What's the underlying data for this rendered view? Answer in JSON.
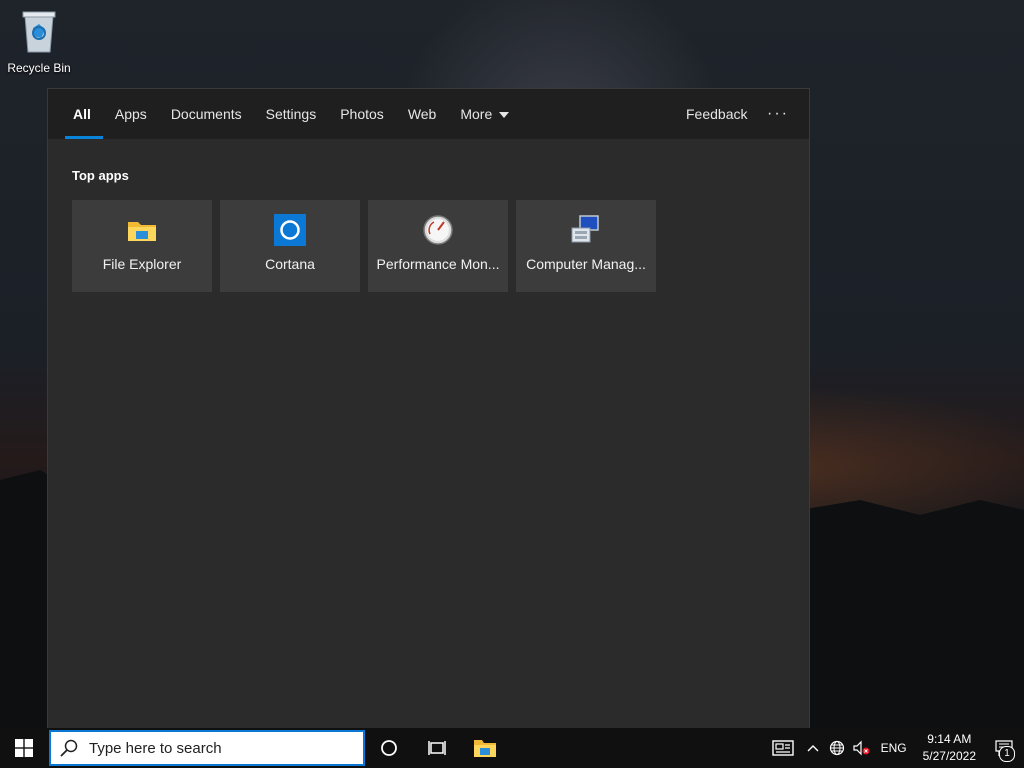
{
  "desktop": {
    "recycle_bin_label": "Recycle Bin"
  },
  "search_flyout": {
    "tabs": [
      {
        "label": "All",
        "active": true
      },
      {
        "label": "Apps"
      },
      {
        "label": "Documents"
      },
      {
        "label": "Settings"
      },
      {
        "label": "Photos"
      },
      {
        "label": "Web"
      },
      {
        "label": "More"
      }
    ],
    "feedback_label": "Feedback",
    "overflow_label": "···",
    "section_title": "Top apps",
    "apps": [
      {
        "label": "File Explorer",
        "icon": "folder-icon"
      },
      {
        "label": "Cortana",
        "icon": "cortana-icon"
      },
      {
        "label": "Performance Mon...",
        "icon": "gauge-icon"
      },
      {
        "label": "Computer Manag...",
        "icon": "computer-management-icon"
      }
    ]
  },
  "taskbar": {
    "search_placeholder": "Type here to search",
    "language": "ENG",
    "time": "9:14 AM",
    "date": "5/27/2022",
    "notification_count": "1"
  },
  "colors": {
    "accent": "#0a84d8",
    "flyout_bg": "#2b2b2b",
    "tabbar_bg": "#1f1f1f",
    "tile_bg": "#3c3c3c"
  }
}
